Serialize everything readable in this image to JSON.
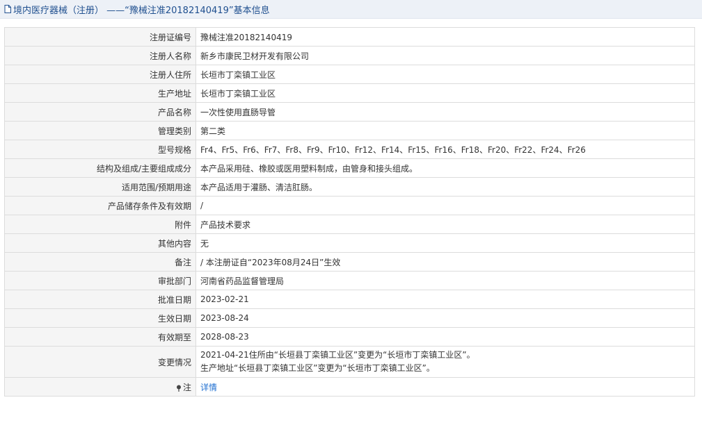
{
  "header": {
    "title": "境内医疗器械（注册） ——“豫械注准20182140419”基本信息",
    "icon": "document-icon"
  },
  "rows": [
    {
      "label": "注册证编号",
      "value": "豫械注准20182140419"
    },
    {
      "label": "注册人名称",
      "value": "新乡市康民卫材开发有限公司"
    },
    {
      "label": "注册人住所",
      "value": "长垣市丁栾镇工业区"
    },
    {
      "label": "生产地址",
      "value": "长垣市丁栾镇工业区"
    },
    {
      "label": "产品名称",
      "value": "一次性使用直肠导管"
    },
    {
      "label": "管理类别",
      "value": "第二类"
    },
    {
      "label": "型号规格",
      "value": "Fr4、Fr5、Fr6、Fr7、Fr8、Fr9、Fr10、Fr12、Fr14、Fr15、Fr16、Fr18、Fr20、Fr22、Fr24、Fr26"
    },
    {
      "label": "结构及组成/主要组成成分",
      "value": "本产品采用硅、橡胶或医用塑料制成，由管身和接头组成。"
    },
    {
      "label": "适用范围/预期用途",
      "value": "本产品适用于灌肠、清洁肛肠。"
    },
    {
      "label": "产品储存条件及有效期",
      "value": "/"
    },
    {
      "label": "附件",
      "value": "产品技术要求"
    },
    {
      "label": "其他内容",
      "value": "无"
    },
    {
      "label": "备注",
      "value": "/ 本注册证自“2023年08月24日”生效"
    },
    {
      "label": "审批部门",
      "value": "河南省药品监督管理局"
    },
    {
      "label": "批准日期",
      "value": "2023-02-21"
    },
    {
      "label": "生效日期",
      "value": "2023-08-24"
    },
    {
      "label": "有效期至",
      "value": "2028-08-23"
    }
  ],
  "change": {
    "label": "变更情况",
    "line1": "2021-04-21住所由“长垣县丁栾镇工业区”变更为“长垣市丁栾镇工业区”。",
    "line2": "生产地址“长垣县丁栾镇工业区”变更为“长垣市丁栾镇工业区”。"
  },
  "note": {
    "label": "注",
    "icon": "pin-icon",
    "link": "详情"
  }
}
